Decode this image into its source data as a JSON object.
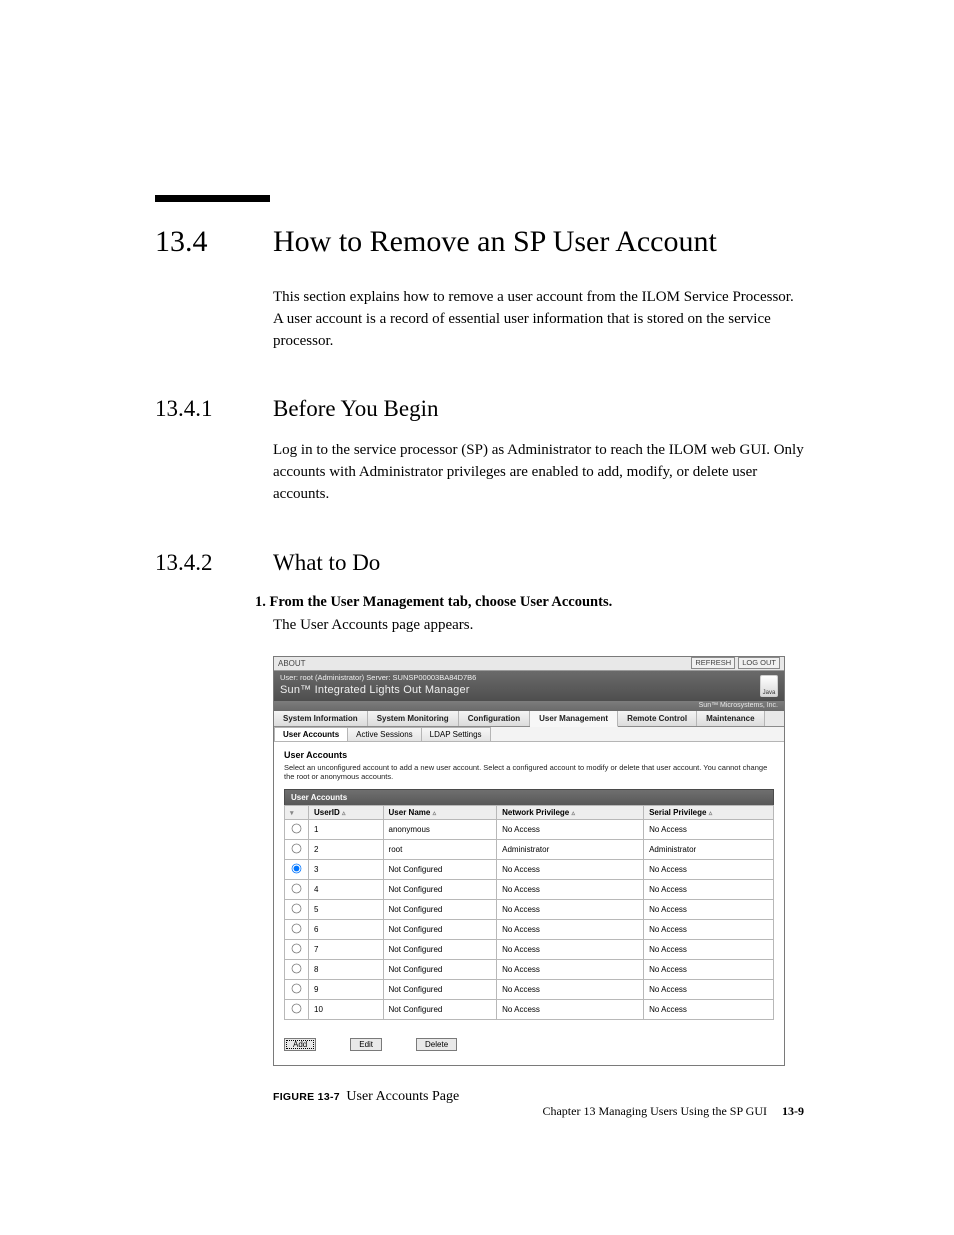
{
  "section": {
    "num": "13.4",
    "title": "How to Remove an SP User Account",
    "intro": "This section explains how to remove a user account from the ILOM Service Processor. A user account is a record of essential user information that is stored on the service processor."
  },
  "sub1": {
    "num": "13.4.1",
    "title": "Before You Begin",
    "body": "Log in to the service processor (SP) as Administrator to reach the ILOM web GUI. Only accounts with Administrator privileges are enabled to add, modify, or delete user accounts."
  },
  "sub2": {
    "num": "13.4.2",
    "title": "What to Do",
    "step1_bold": "1. From the User Management tab, choose User Accounts.",
    "step1_after": "The User Accounts page appears."
  },
  "shot": {
    "about": "ABOUT",
    "refresh": "REFRESH",
    "logout": "LOG OUT",
    "userline": "User: root (Administrator)   Server: SUNSP00003BA84D7B6",
    "product": "Sun™ Integrated Lights Out Manager",
    "java": "Java",
    "vendor": "Sun™ Microsystems, Inc.",
    "tabs": [
      "System Information",
      "System Monitoring",
      "Configuration",
      "User Management",
      "Remote Control",
      "Maintenance"
    ],
    "tabs_active_index": 3,
    "subtabs": [
      "User Accounts",
      "Active Sessions",
      "LDAP Settings"
    ],
    "subtabs_active_index": 0,
    "panel_title": "User Accounts",
    "panel_hint": "Select an unconfigured account to add a new user account. Select a configured account to modify or delete that user account. You cannot change the root or anonymous accounts.",
    "table_title": "User Accounts",
    "columns": [
      "",
      "UserID",
      "User Name",
      "Network Privilege",
      "Serial Privilege"
    ],
    "rows": [
      {
        "selected": false,
        "id": "1",
        "name": "anonymous",
        "net": "No Access",
        "ser": "No Access"
      },
      {
        "selected": false,
        "id": "2",
        "name": "root",
        "net": "Administrator",
        "ser": "Administrator"
      },
      {
        "selected": true,
        "id": "3",
        "name": "Not Configured",
        "net": "No Access",
        "ser": "No Access"
      },
      {
        "selected": false,
        "id": "4",
        "name": "Not Configured",
        "net": "No Access",
        "ser": "No Access"
      },
      {
        "selected": false,
        "id": "5",
        "name": "Not Configured",
        "net": "No Access",
        "ser": "No Access"
      },
      {
        "selected": false,
        "id": "6",
        "name": "Not Configured",
        "net": "No Access",
        "ser": "No Access"
      },
      {
        "selected": false,
        "id": "7",
        "name": "Not Configured",
        "net": "No Access",
        "ser": "No Access"
      },
      {
        "selected": false,
        "id": "8",
        "name": "Not Configured",
        "net": "No Access",
        "ser": "No Access"
      },
      {
        "selected": false,
        "id": "9",
        "name": "Not Configured",
        "net": "No Access",
        "ser": "No Access"
      },
      {
        "selected": false,
        "id": "10",
        "name": "Not Configured",
        "net": "No Access",
        "ser": "No Access"
      }
    ],
    "buttons": {
      "add": "Add",
      "edit": "Edit",
      "delete": "Delete"
    }
  },
  "figure": {
    "label": "FIGURE 13-7",
    "text": "User Accounts Page"
  },
  "footer": {
    "chapter": "Chapter 13   Managing Users Using the SP GUI",
    "page": "13-9"
  }
}
